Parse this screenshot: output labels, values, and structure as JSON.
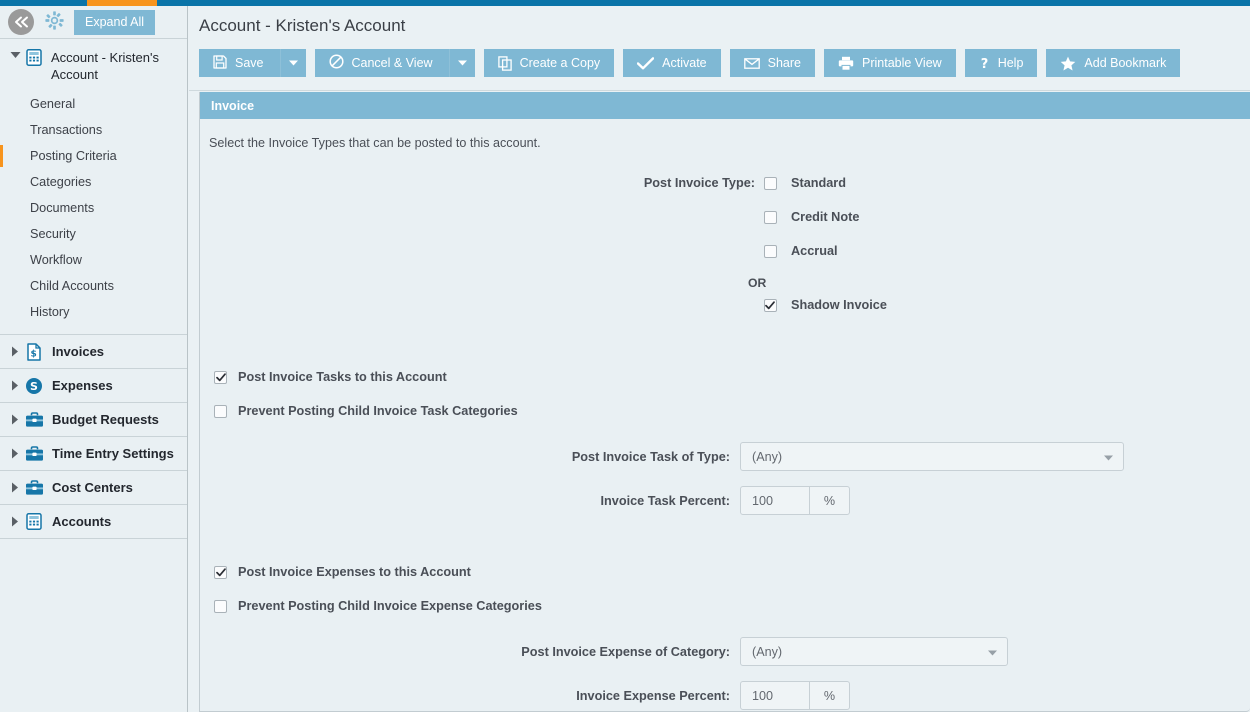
{
  "top_bar": {
    "accent_color": "#0a74a8",
    "highlight_color": "#f7941d"
  },
  "sidebar": {
    "collapse_icon": "double-chevron-left-icon",
    "gear_icon": "gear-icon",
    "expand_all_label": "Expand All",
    "tree": {
      "root_label": "Account - Kristen's Account",
      "root_icon": "calculator-icon",
      "root_expanded": true,
      "children": [
        {
          "label": "General",
          "active": false
        },
        {
          "label": "Transactions",
          "active": false
        },
        {
          "label": "Posting Criteria",
          "active": true
        },
        {
          "label": "Categories",
          "active": false
        },
        {
          "label": "Documents",
          "active": false
        },
        {
          "label": "Security",
          "active": false
        },
        {
          "label": "Workflow",
          "active": false
        },
        {
          "label": "Child Accounts",
          "active": false
        },
        {
          "label": "History",
          "active": false
        }
      ]
    },
    "groups": [
      {
        "label": "Invoices",
        "icon": "invoice-document-icon",
        "expanded": false
      },
      {
        "label": "Expenses",
        "icon": "dollar-circle-icon",
        "expanded": false
      },
      {
        "label": "Budget Requests",
        "icon": "briefcase-icon",
        "expanded": false
      },
      {
        "label": "Time Entry Settings",
        "icon": "briefcase-icon",
        "expanded": false
      },
      {
        "label": "Cost Centers",
        "icon": "briefcase-icon",
        "expanded": false
      },
      {
        "label": "Accounts",
        "icon": "calculator-icon",
        "expanded": false
      }
    ]
  },
  "header": {
    "title": "Account - Kristen's Account"
  },
  "toolbar": {
    "buttons": [
      {
        "label": "Save",
        "icon": "floppy-disk-icon",
        "has_dropdown": true
      },
      {
        "label": "Cancel & View",
        "icon": "cancel-circle-icon",
        "has_dropdown": true
      },
      {
        "label": "Create a Copy",
        "icon": "copy-icon",
        "has_dropdown": false
      },
      {
        "label": "Activate",
        "icon": "checkmark-icon",
        "has_dropdown": false
      },
      {
        "label": "Share",
        "icon": "envelope-icon",
        "has_dropdown": false
      },
      {
        "label": "Printable View",
        "icon": "printer-icon",
        "has_dropdown": false
      },
      {
        "label": "Help",
        "icon": "question-mark-icon",
        "has_dropdown": false
      },
      {
        "label": "Add Bookmark",
        "icon": "star-icon",
        "has_dropdown": false
      }
    ]
  },
  "panel": {
    "title": "Invoice",
    "intro": "Select the Invoice Types that can be posted to this account.",
    "post_invoice_type": {
      "label": "Post Invoice Type:",
      "options": [
        {
          "label": "Standard",
          "checked": false
        },
        {
          "label": "Credit Note",
          "checked": false
        },
        {
          "label": "Accrual",
          "checked": false
        }
      ],
      "or_label": "OR",
      "shadow": {
        "label": "Shadow Invoice",
        "checked": true
      }
    },
    "task_section": {
      "post_tasks": {
        "label": "Post Invoice Tasks to this Account",
        "checked": true
      },
      "prevent_child": {
        "label": "Prevent Posting Child Invoice Task Categories",
        "checked": false
      },
      "type_label": "Post Invoice Task of Type:",
      "type_value": "(Any)",
      "percent_label": "Invoice Task Percent:",
      "percent_value": "100",
      "percent_suffix": "%"
    },
    "expense_section": {
      "post_expenses": {
        "label": "Post Invoice Expenses to this Account",
        "checked": true
      },
      "prevent_child": {
        "label": "Prevent Posting Child Invoice Expense Categories",
        "checked": false
      },
      "category_label": "Post Invoice Expense of Category:",
      "category_value": "(Any)",
      "percent_label": "Invoice Expense Percent:",
      "percent_value": "100",
      "percent_suffix": "%"
    }
  }
}
